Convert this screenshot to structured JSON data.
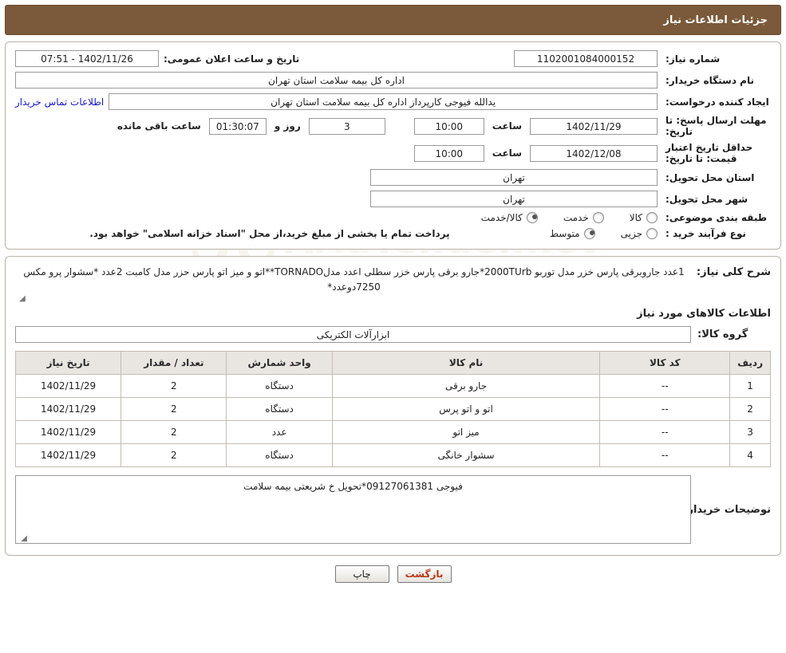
{
  "header": {
    "title": "جزئیات اطلاعات نیاز"
  },
  "form": {
    "need_number_label": "شماره نیاز:",
    "need_number_value": "1102001084000152",
    "public_announce_label": "تاریخ و ساعت اعلان عمومی:",
    "public_announce_value": "1402/11/26 - 07:51",
    "buyer_org_label": "نام دستگاه خریدار:",
    "buyer_org_value": "اداره کل بیمه سلامت استان تهران",
    "requester_label": "ایجاد کننده درخواست:",
    "requester_value": "یدالله فیوجی کارپرداز اداره کل بیمه سلامت استان تهران",
    "contact_link": "اطلاعات تماس خریدار",
    "deadline_label": "مهلت ارسال پاسخ: تا تاریخ:",
    "deadline_date": "1402/11/29",
    "deadline_hour_label": "ساعت",
    "deadline_hour": "10:00",
    "remaining_days": "3",
    "remaining_days_label": "روز و",
    "remaining_time": "01:30:07",
    "remaining_suffix": "ساعت باقی مانده",
    "price_validity_label": "حداقل تاریخ اعتبار قیمت: تا تاریخ:",
    "price_validity_date": "1402/12/08",
    "price_validity_hour_label": "ساعت",
    "price_validity_hour": "10:00",
    "province_label": "استان محل تحویل:",
    "province_value": "تهران",
    "city_label": "شهر محل تحویل:",
    "city_value": "تهران",
    "category_label": "طبقه بندی موضوعی:",
    "category_options": [
      "کالا",
      "خدمت",
      "کالا/خدمت"
    ],
    "category_selected": "کالا/خدمت",
    "process_label": "نوع فرآیند خرید :",
    "process_options": [
      "جزیی",
      "متوسط"
    ],
    "process_selected": "متوسط",
    "process_note": "پرداخت تمام یا بخشی از مبلغ خرید،از محل \"اسناد خزانه اسلامی\" خواهد بود."
  },
  "description": {
    "label": "شرح کلی نیاز:",
    "text": "1عدد جاروبرقی پارس خزر مدل توربو 2000TUrb*جارو برقی پارس خزر سطلی اعدد مدلTORNADO**اتو و میز اتو پارس حزر مدل کامبت 2عدد *سشوار پرو مکس  7250دوعدد*"
  },
  "items_section": {
    "title": "اطلاعات کالاهای مورد نیاز",
    "group_label": "گروه کالا:",
    "group_value": "ابزارآلات الکتریکی",
    "columns": [
      "ردیف",
      "کد کالا",
      "نام کالا",
      "واحد شمارش",
      "تعداد / مقدار",
      "تاریخ نیاز"
    ],
    "rows": [
      {
        "radif": "1",
        "code": "--",
        "name": "جارو برقی",
        "unit": "دستگاه",
        "qty": "2",
        "date": "1402/11/29"
      },
      {
        "radif": "2",
        "code": "--",
        "name": "اتو و اتو پرس",
        "unit": "دستگاه",
        "qty": "2",
        "date": "1402/11/29"
      },
      {
        "radif": "3",
        "code": "--",
        "name": "میز اتو",
        "unit": "عدد",
        "qty": "2",
        "date": "1402/11/29"
      },
      {
        "radif": "4",
        "code": "--",
        "name": "سشوار خانگی",
        "unit": "دستگاه",
        "qty": "2",
        "date": "1402/11/29"
      }
    ]
  },
  "notes": {
    "label": "توضیحات خریدار:",
    "text": "فیوجی 09127061381*تحویل خ شریعتی بیمه سلامت"
  },
  "footer": {
    "print_label": "چاپ",
    "back_label": "بازگشت"
  },
  "watermark": {
    "text": "AriaTender",
    "suffix": ".net"
  }
}
